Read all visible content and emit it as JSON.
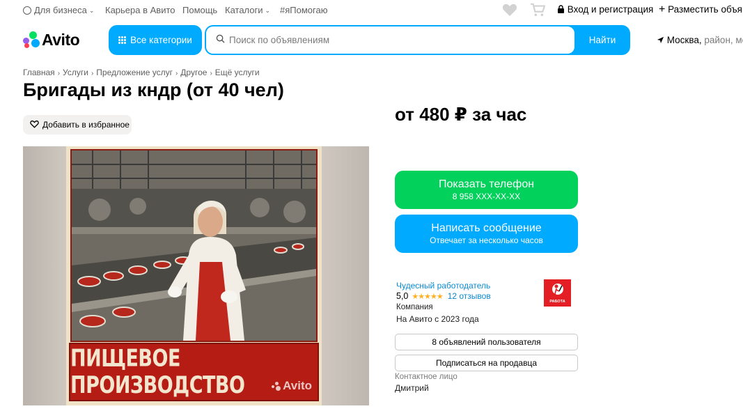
{
  "topbar": {
    "business": "Для бизнеса",
    "career": "Карьера в Авито",
    "help": "Помощь",
    "catalogs": "Каталоги",
    "help_tag": "#яПомогаю",
    "login": "Вход и регистрация",
    "post_ad": "Разместить объя"
  },
  "header": {
    "logo": "Avito",
    "categories_label": "Все категории",
    "search_placeholder": "Поиск по объявлениям",
    "search_button": "Найти",
    "location_city": "Москва,",
    "location_rest": "район, ме"
  },
  "breadcrumbs": [
    "Главная",
    "Услуги",
    "Предложение услуг",
    "Другое",
    "Ещё услуги"
  ],
  "listing": {
    "title": "Бригады из кндр (от 40 чел)",
    "favorite_label": "Добавить в избранное",
    "price": "от 480 ₽ за час",
    "image_caption": "ПИЩЕВОЕ ПРОИЗВОДСТВО",
    "watermark": "Avito"
  },
  "actions": {
    "phone_label": "Показать телефон",
    "phone_number": "8 958 XXX-XX-XX",
    "message_label": "Написать сообщение",
    "message_sub": "Отвечает за несколько часов"
  },
  "seller": {
    "name": "Чудесный работодатель",
    "rating": "5,0",
    "stars": "★★★★★",
    "reviews": "12 отзывов",
    "type": "Компания",
    "since": "На Авито с 2023 года",
    "logo_text": "РАБОТА",
    "ads_button": "8 объявлений пользователя",
    "subscribe_button": "Подписаться на продавца",
    "contact_label": "Контактное лицо",
    "contact_name": "Дмитрий"
  },
  "colors": {
    "accent_blue": "#00aaff",
    "green": "#02d15c",
    "link_blue": "#0a8ad2",
    "star": "#ffb021"
  }
}
